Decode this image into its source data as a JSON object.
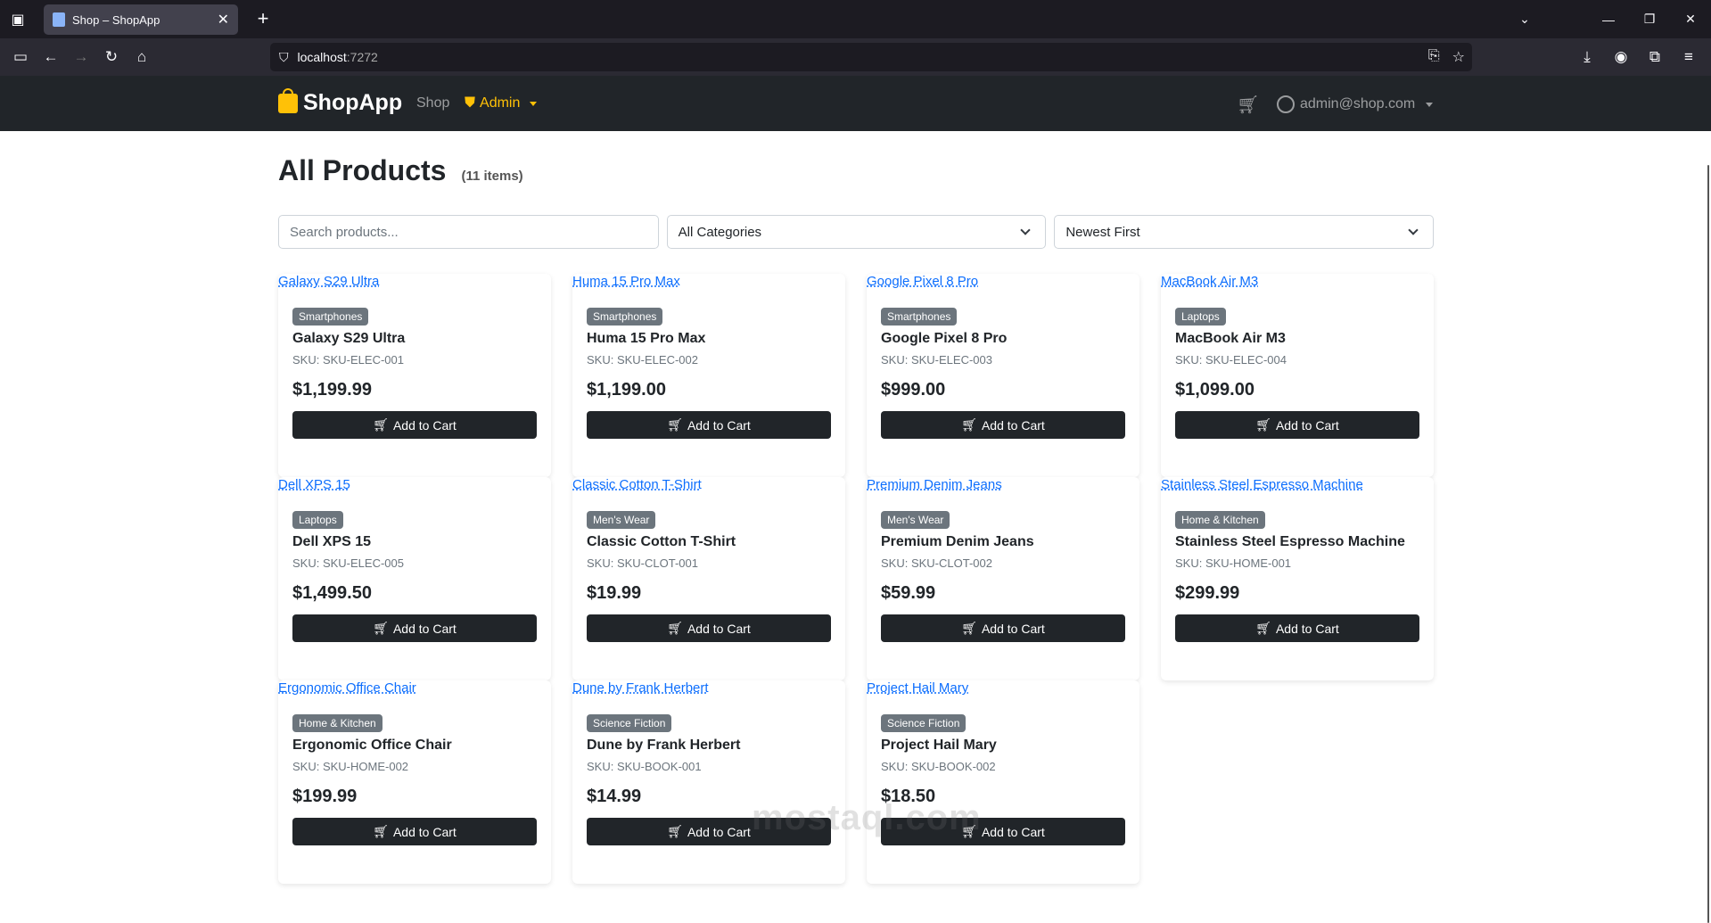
{
  "browser": {
    "tab_title": "Shop – ShopApp",
    "url_host": "localhost",
    "url_port": ":7272"
  },
  "app": {
    "brand": "ShopApp",
    "nav_shop": "Shop",
    "nav_admin": "Admin",
    "user_email": "admin@shop.com"
  },
  "page": {
    "title": "All Products",
    "count": "(11 items)",
    "search_placeholder": "Search products...",
    "category_select": "All Categories",
    "sort_select": "Newest First",
    "add_to_cart_label": "Add to Cart"
  },
  "products": [
    {
      "link": "Galaxy S29 Ultra",
      "category": "Smartphones",
      "name": "Galaxy S29 Ultra",
      "sku": "SKU: SKU-ELEC-001",
      "price": "$1,199.99"
    },
    {
      "link": "Huma 15 Pro Max",
      "category": "Smartphones",
      "name": "Huma 15 Pro Max",
      "sku": "SKU: SKU-ELEC-002",
      "price": "$1,199.00"
    },
    {
      "link": "Google Pixel 8 Pro",
      "category": "Smartphones",
      "name": "Google Pixel 8 Pro",
      "sku": "SKU: SKU-ELEC-003",
      "price": "$999.00"
    },
    {
      "link": "MacBook Air M3",
      "category": "Laptops",
      "name": "MacBook Air M3",
      "sku": "SKU: SKU-ELEC-004",
      "price": "$1,099.00"
    },
    {
      "link": "Dell XPS 15",
      "category": "Laptops",
      "name": "Dell XPS 15",
      "sku": "SKU: SKU-ELEC-005",
      "price": "$1,499.50"
    },
    {
      "link": "Classic Cotton T-Shirt",
      "category": "Men's Wear",
      "name": "Classic Cotton T-Shirt",
      "sku": "SKU: SKU-CLOT-001",
      "price": "$19.99"
    },
    {
      "link": "Premium Denim Jeans",
      "category": "Men's Wear",
      "name": "Premium Denim Jeans",
      "sku": "SKU: SKU-CLOT-002",
      "price": "$59.99"
    },
    {
      "link": "Stainless Steel Espresso Machine",
      "category": "Home & Kitchen",
      "name": "Stainless Steel Espresso Machine",
      "sku": "SKU: SKU-HOME-001",
      "price": "$299.99"
    },
    {
      "link": "Ergonomic Office Chair",
      "category": "Home & Kitchen",
      "name": "Ergonomic Office Chair",
      "sku": "SKU: SKU-HOME-002",
      "price": "$199.99"
    },
    {
      "link": "Dune by Frank Herbert",
      "category": "Science Fiction",
      "name": "Dune by Frank Herbert",
      "sku": "SKU: SKU-BOOK-001",
      "price": "$14.99"
    },
    {
      "link": "Project Hail Mary",
      "category": "Science Fiction",
      "name": "Project Hail Mary",
      "sku": "SKU: SKU-BOOK-002",
      "price": "$18.50"
    }
  ],
  "watermark": "mostaql.com",
  "colors": {
    "accent": "#ffc107",
    "header": "#212529",
    "link": "#0d6efd",
    "badge": "#6c757d"
  }
}
